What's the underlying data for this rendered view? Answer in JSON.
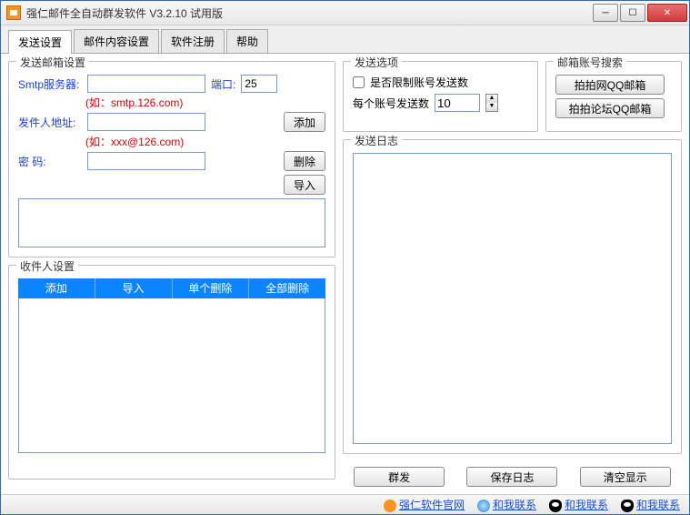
{
  "window": {
    "title": "强仁邮件全自动群发软件 V3.2.10 试用版"
  },
  "tabs": [
    "发送设置",
    "邮件内容设置",
    "软件注册",
    "帮助"
  ],
  "sendbox": {
    "legend": "发送邮箱设置",
    "smtp_label": "Smtp服务器:",
    "smtp_value": "",
    "port_label": "端口:",
    "port_value": "25",
    "smtp_hint": "(如：smtp.126.com)",
    "addr_label": "发件人地址:",
    "addr_value": "",
    "addr_hint": "(如：xxx@126.com)",
    "pwd_label": "密    码:",
    "pwd_value": "",
    "btn_add": "添加",
    "btn_del": "删除",
    "btn_import": "导入"
  },
  "recvbox": {
    "legend": "收件人设置",
    "btns": [
      "添加",
      "导入",
      "单个删除",
      "全部删除"
    ]
  },
  "options": {
    "legend": "发送选项",
    "limit_label": "是否限制账号发送数",
    "limit_checked": false,
    "peraccount_label": "每个账号发送数",
    "peraccount_value": "10"
  },
  "search": {
    "legend": "邮箱账号搜索",
    "btn1": "拍拍网QQ邮箱",
    "btn2": "拍拍论坛QQ邮箱"
  },
  "log": {
    "legend": "发送日志"
  },
  "actions": {
    "send": "群发",
    "savelog": "保存日志",
    "clear": "清空显示"
  },
  "footer": {
    "link1": "强仁软件官网",
    "link2": "和我联系",
    "link3": "和我联系",
    "link4": "和我联系"
  }
}
